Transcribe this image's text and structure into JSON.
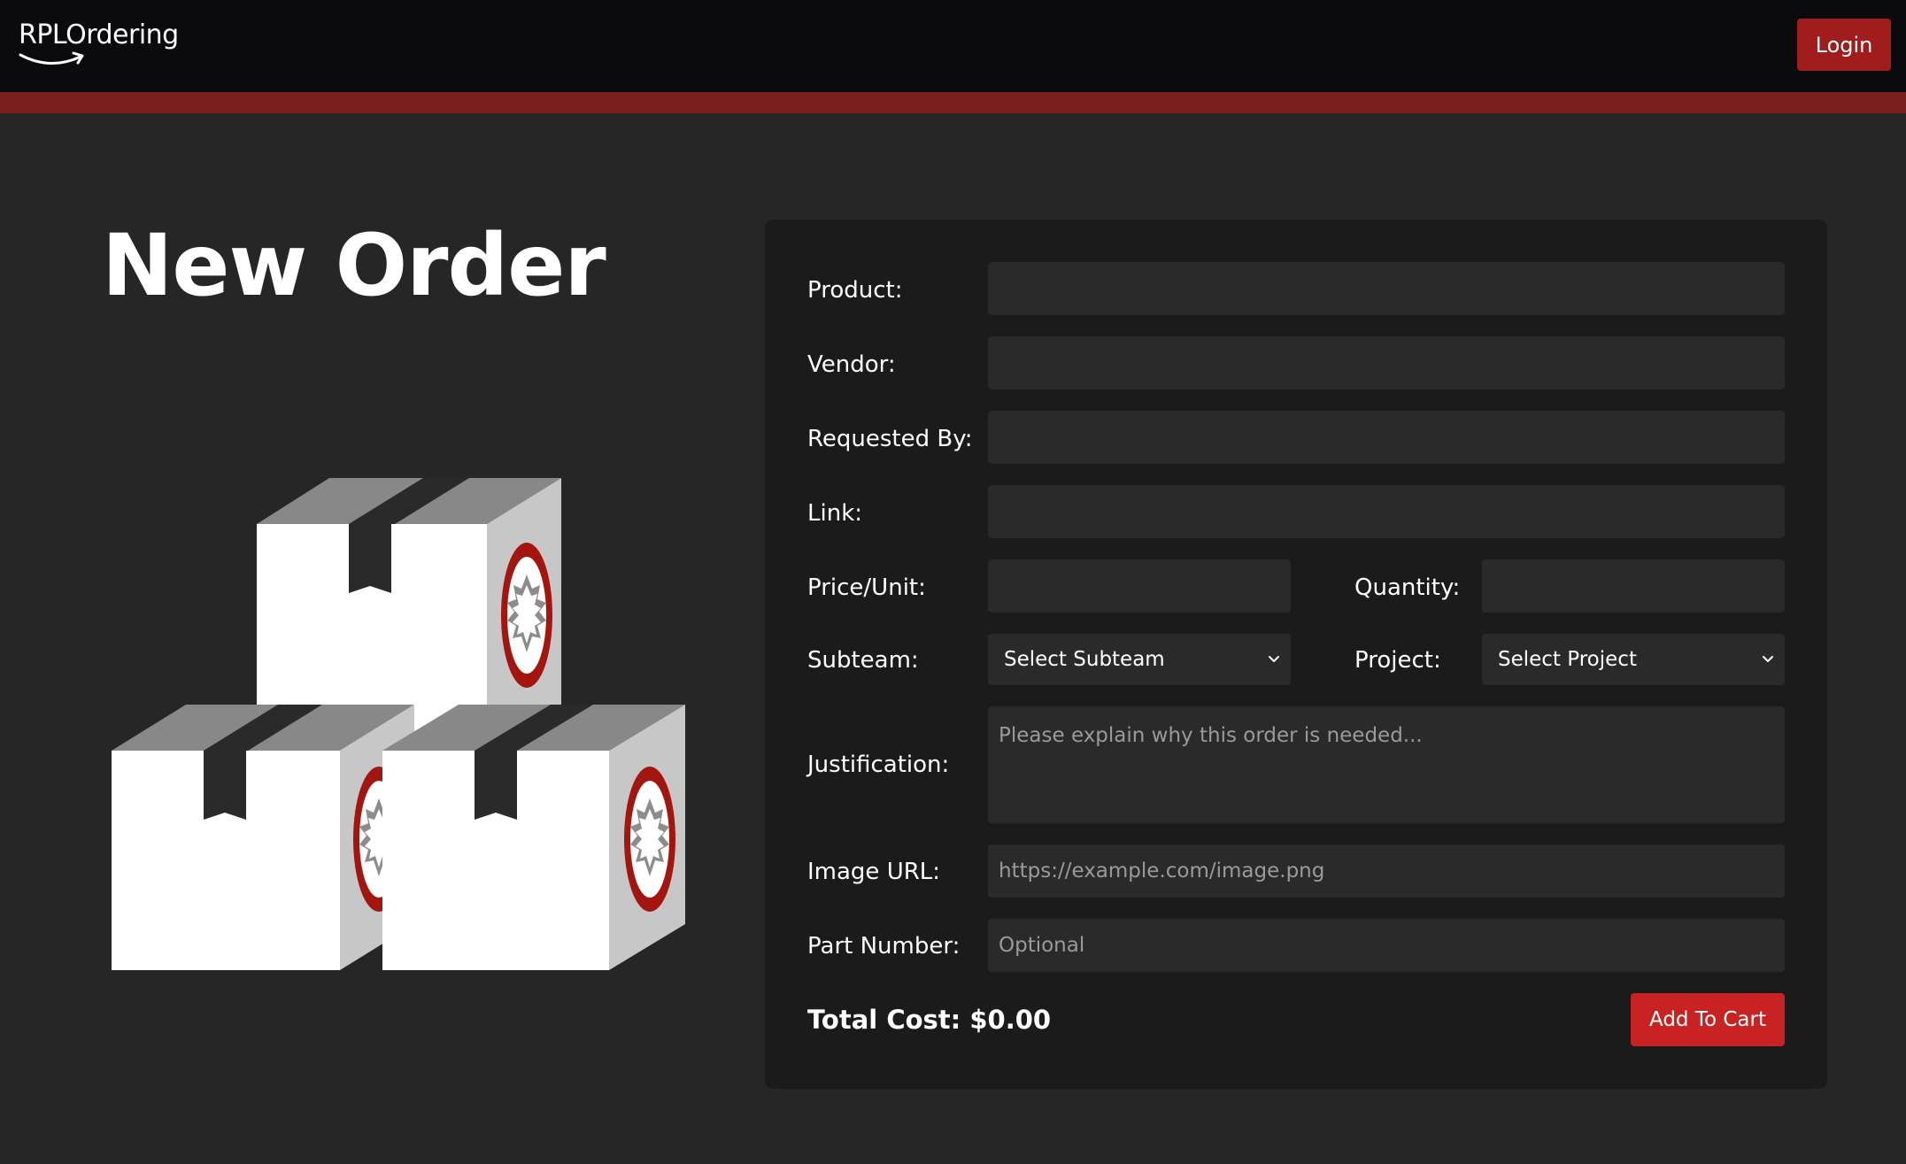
{
  "nav": {
    "brand": "RPLOrdering",
    "login_label": "Login"
  },
  "main": {
    "title": "New Order"
  },
  "form": {
    "product_label": "Product:",
    "vendor_label": "Vendor:",
    "requested_by_label": "Requested By:",
    "link_label": "Link:",
    "price_label": "Price/Unit:",
    "quantity_label": "Quantity:",
    "subteam_label": "Subteam:",
    "subteam_value": "Select Subteam",
    "project_label": "Project:",
    "project_value": "Select Project",
    "justification_label": "Justification:",
    "justification_placeholder": "Please explain why this order is needed...",
    "image_url_label": "Image URL:",
    "image_url_placeholder": "https://example.com/image.png",
    "part_number_label": "Part Number:",
    "part_number_placeholder": "Optional",
    "total_cost": "Total Cost: $0.00",
    "add_to_cart_label": "Add To Cart"
  },
  "colors": {
    "page_bg": "#262626",
    "nav_bg": "#0b0b0e",
    "accent_bar": "#7a1f1f",
    "card_bg": "#1b1b1b",
    "field_bg": "#2a2a2a",
    "primary_button": "#c92222",
    "login_button": "#a11c1c"
  },
  "icons": {
    "logo_smile": "smile-arrow-icon",
    "dropdown": "chevron-down-icon",
    "illustration": "stacked-boxes-illustration"
  }
}
